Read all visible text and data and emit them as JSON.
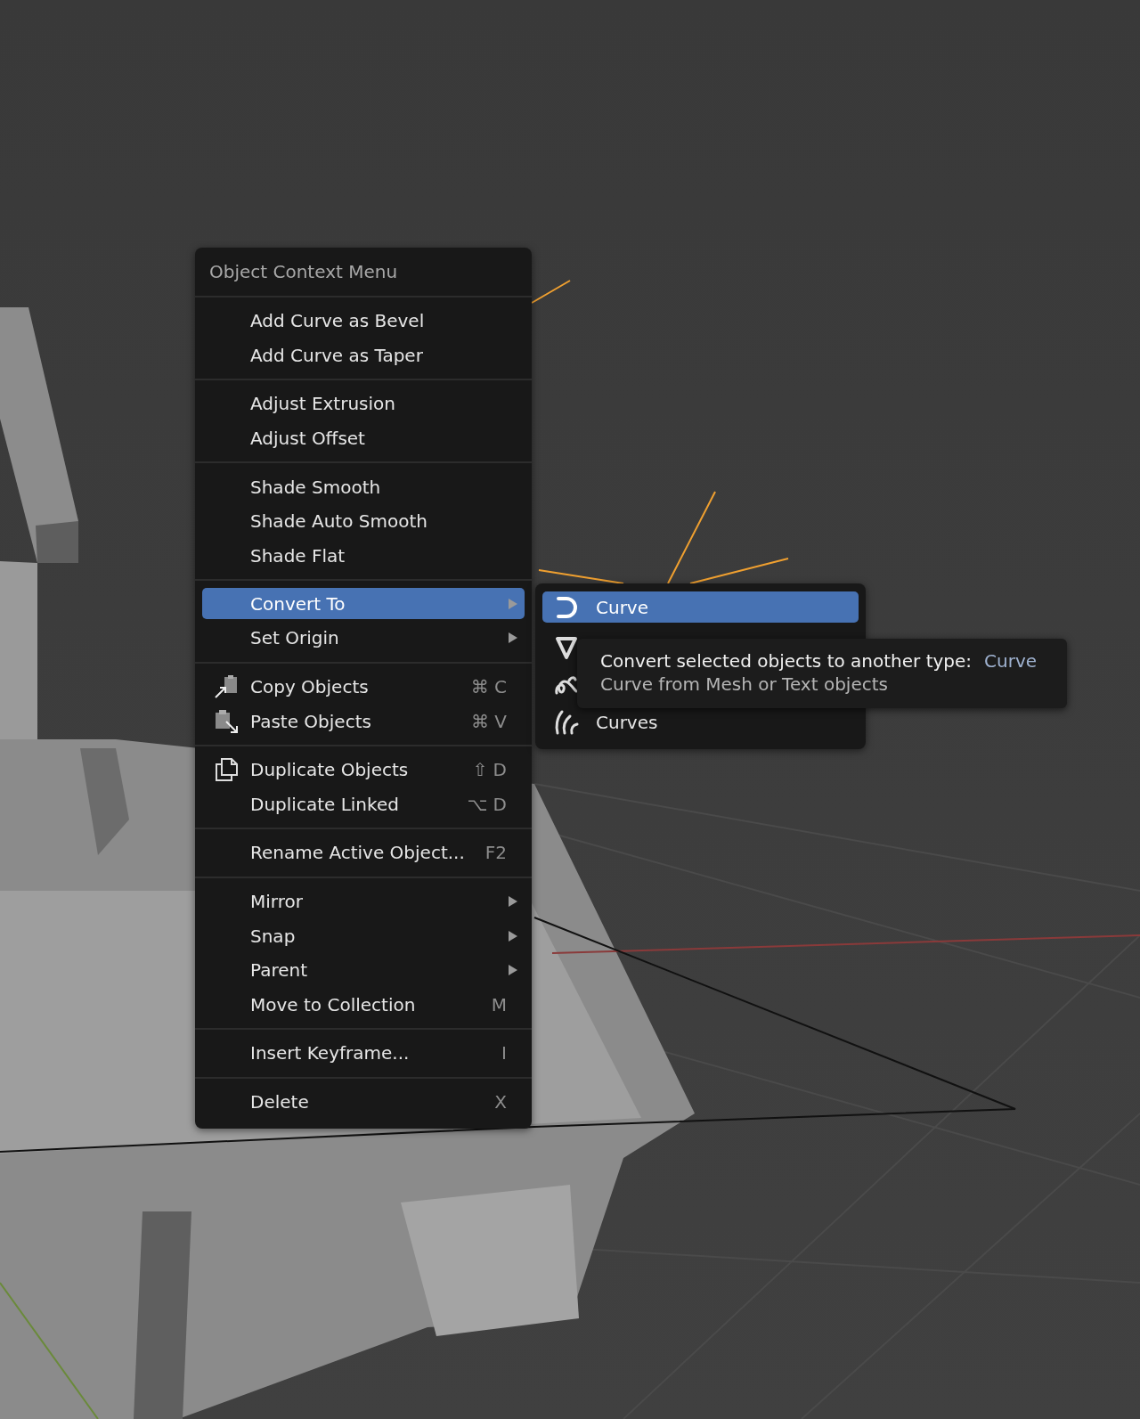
{
  "context_menu": {
    "title": "Object Context Menu",
    "sections": [
      {
        "items": [
          {
            "label": "Add Curve as Bevel",
            "kind": "plain",
            "submenu": false,
            "selected": false
          },
          {
            "label": "Add Curve as Taper",
            "kind": "plain",
            "submenu": false,
            "selected": false
          }
        ]
      },
      {
        "items": [
          {
            "label": "Adjust Extrusion",
            "kind": "plain",
            "submenu": false,
            "selected": false
          },
          {
            "label": "Adjust Offset",
            "kind": "plain",
            "submenu": false,
            "selected": false
          }
        ]
      },
      {
        "items": [
          {
            "label": "Shade Smooth",
            "kind": "plain",
            "submenu": false,
            "selected": false
          },
          {
            "label": "Shade Auto Smooth",
            "kind": "plain",
            "submenu": false,
            "selected": false
          },
          {
            "label": "Shade Flat",
            "kind": "plain",
            "submenu": false,
            "selected": false
          }
        ]
      },
      {
        "items": [
          {
            "label": "Convert To",
            "kind": "plain",
            "submenu": true,
            "selected": true
          },
          {
            "label": "Set Origin",
            "kind": "plain",
            "submenu": true,
            "selected": false
          }
        ]
      },
      {
        "items": [
          {
            "label": "Copy Objects",
            "kind": "copy",
            "shortcut": "⌘ C",
            "submenu": false,
            "selected": false
          },
          {
            "label": "Paste Objects",
            "kind": "paste",
            "shortcut": "⌘ V",
            "submenu": false,
            "selected": false
          }
        ]
      },
      {
        "items": [
          {
            "label": "Duplicate Objects",
            "kind": "duplicate",
            "shortcut": "⇧ D",
            "submenu": false,
            "selected": false
          },
          {
            "label": "Duplicate Linked",
            "kind": "plain",
            "shortcut": "⌥ D",
            "submenu": false,
            "selected": false
          }
        ]
      },
      {
        "items": [
          {
            "label": "Rename Active Object...",
            "kind": "plain",
            "shortcut": "F2",
            "submenu": false,
            "selected": false
          }
        ]
      },
      {
        "items": [
          {
            "label": "Mirror",
            "kind": "plain",
            "submenu": true,
            "selected": false
          },
          {
            "label": "Snap",
            "kind": "plain",
            "submenu": true,
            "selected": false
          },
          {
            "label": "Parent",
            "kind": "plain",
            "submenu": true,
            "selected": false
          },
          {
            "label": "Move to Collection",
            "kind": "plain",
            "shortcut": "M",
            "submenu": false,
            "selected": false
          }
        ]
      },
      {
        "items": [
          {
            "label": "Insert Keyframe...",
            "kind": "plain",
            "shortcut": "I",
            "submenu": false,
            "selected": false
          }
        ]
      },
      {
        "items": [
          {
            "label": "Delete",
            "kind": "plain",
            "shortcut": "X",
            "submenu": false,
            "selected": false
          }
        ]
      }
    ]
  },
  "convert_submenu": {
    "items": [
      {
        "kind": "curve",
        "label": "Curve",
        "selected": true
      },
      {
        "kind": "mesh",
        "selected": false
      },
      {
        "kind": "grease_pencil",
        "selected": false
      },
      {
        "kind": "curves",
        "label": "Curves",
        "selected": false
      }
    ]
  },
  "tooltip": {
    "description": "Convert selected objects to another type:",
    "value": "Curve",
    "detail": "Curve from Mesh or Text objects"
  }
}
